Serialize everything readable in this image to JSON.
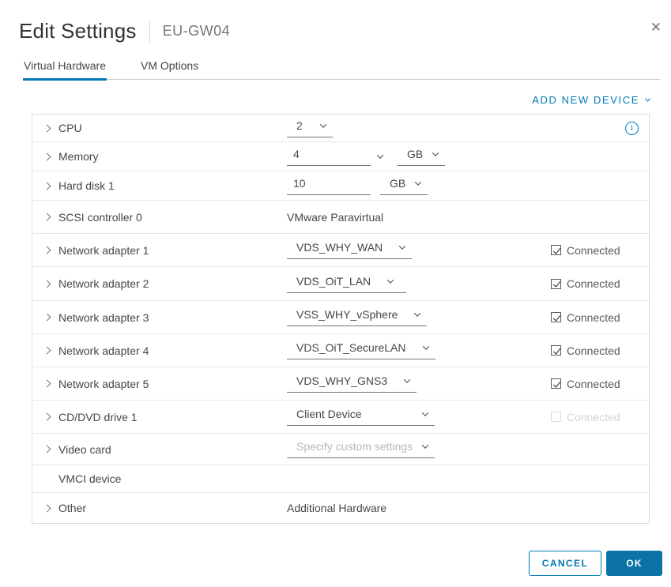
{
  "dialog": {
    "title": "Edit Settings",
    "vm_name": "EU-GW04"
  },
  "icons": {
    "close": "✕",
    "info": "i"
  },
  "tabs": [
    {
      "label": "Virtual Hardware",
      "active": true
    },
    {
      "label": "VM Options",
      "active": false
    }
  ],
  "toolbar": {
    "add_new_device_label": "ADD NEW DEVICE"
  },
  "checkbox_label": "Connected",
  "hardware_rows": [
    {
      "label": "CPU",
      "control": "select",
      "value": "2",
      "info": true
    },
    {
      "label": "Memory",
      "control": "combo-input",
      "value": "4",
      "unit": "GB"
    },
    {
      "label": "Hard disk 1",
      "control": "input-unit",
      "value": "10",
      "unit": "GB"
    },
    {
      "label": "SCSI controller 0",
      "control": "text",
      "value": "VMware Paravirtual"
    },
    {
      "label": "Network adapter 1",
      "control": "select",
      "value": "VDS_WHY_WAN",
      "connected": true
    },
    {
      "label": "Network adapter 2",
      "control": "select",
      "value": "VDS_OiT_LAN",
      "connected": true
    },
    {
      "label": "Network adapter 3",
      "control": "select",
      "value": "VSS_WHY_vSphere",
      "connected": true
    },
    {
      "label": "Network adapter 4",
      "control": "select",
      "value": "VDS_OiT_SecureLAN",
      "connected": true
    },
    {
      "label": "Network adapter 5",
      "control": "select",
      "value": "VDS_WHY_GNS3",
      "connected": true
    },
    {
      "label": "CD/DVD drive 1",
      "control": "select-wide",
      "value": "Client Device",
      "connected": false,
      "disabled": true
    },
    {
      "label": "Video card",
      "control": "select-wide",
      "value": "Specify custom settings",
      "muted": true
    },
    {
      "label": "VMCI device",
      "control": "none",
      "value": ""
    },
    {
      "label": "Other",
      "control": "text",
      "value": "Additional Hardware"
    }
  ],
  "footer": {
    "cancel_label": "CANCEL",
    "ok_label": "OK"
  },
  "colors": {
    "accent": "#0079b8",
    "primary_button": "#0c73a7",
    "tab_underline": "#0079b8"
  }
}
